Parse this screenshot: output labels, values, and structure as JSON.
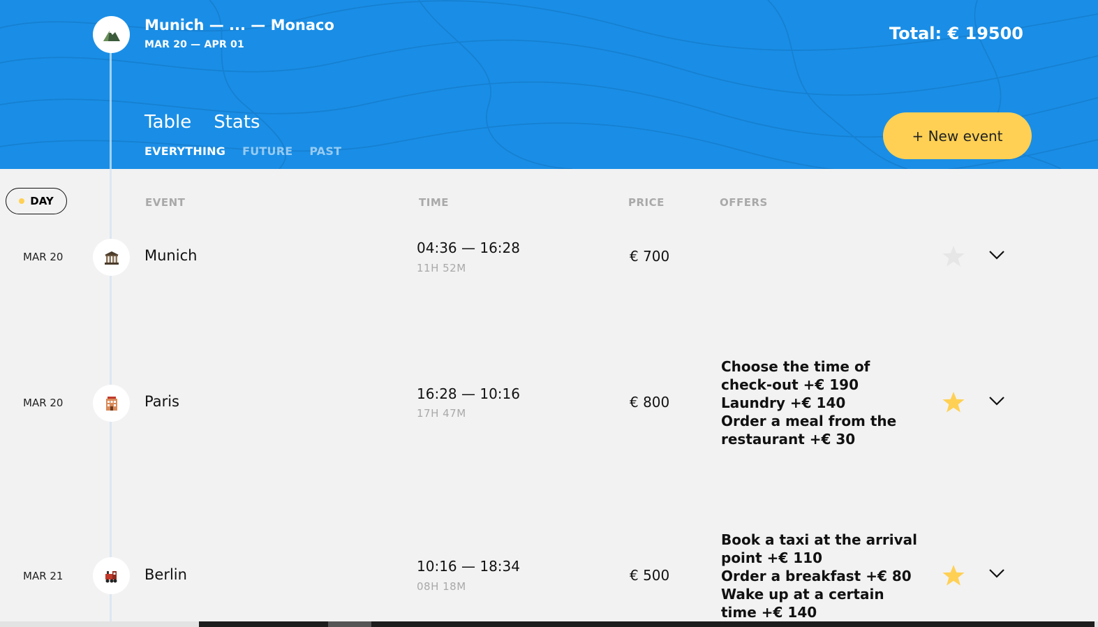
{
  "trip": {
    "title": "Munich — ... — Monaco",
    "dates": "MAR 20 — APR 01",
    "total": "Total: € 19500",
    "icon": "mountain-icon"
  },
  "tabs": [
    {
      "label": "Table"
    },
    {
      "label": "Stats"
    }
  ],
  "filters": [
    {
      "label": "EVERYTHING",
      "active": true
    },
    {
      "label": "FUTURE",
      "active": false
    },
    {
      "label": "PAST",
      "active": false
    }
  ],
  "new_event_label": "+ New event",
  "columns": {
    "day": "DAY",
    "event": "EVENT",
    "time": "TIME",
    "price": "PRICE",
    "offers": "OFFERS"
  },
  "colors": {
    "header_blue": "#1a8ee6",
    "accent_yellow": "#ffd054",
    "star_inactive": "#e6e6e6",
    "star_active": "#ffd054"
  },
  "events": [
    {
      "date": "MAR 20",
      "icon": "museum-icon",
      "name": "Munich",
      "time": "04:36 — 16:28",
      "duration": "11H 52M",
      "price": "€ 700",
      "offers": [],
      "favorite": false
    },
    {
      "date": "MAR 20",
      "icon": "hotel-icon",
      "name": "Paris",
      "time": "16:28 — 10:16",
      "duration": "17H 47M",
      "price": "€ 800",
      "offers": [
        "Choose the time of check-out +€  190",
        "Laundry +€  140",
        "Order a meal from the restaurant +€  30"
      ],
      "favorite": true
    },
    {
      "date": "MAR 21",
      "icon": "train-icon",
      "name": "Berlin",
      "time": "10:16 — 18:34",
      "duration": "08H 18M",
      "price": "€ 500",
      "offers": [
        "Book a taxi at the arrival point +€  110",
        "Order a breakfast +€  80",
        "Wake up at a certain time +€  140"
      ],
      "favorite": true
    }
  ]
}
